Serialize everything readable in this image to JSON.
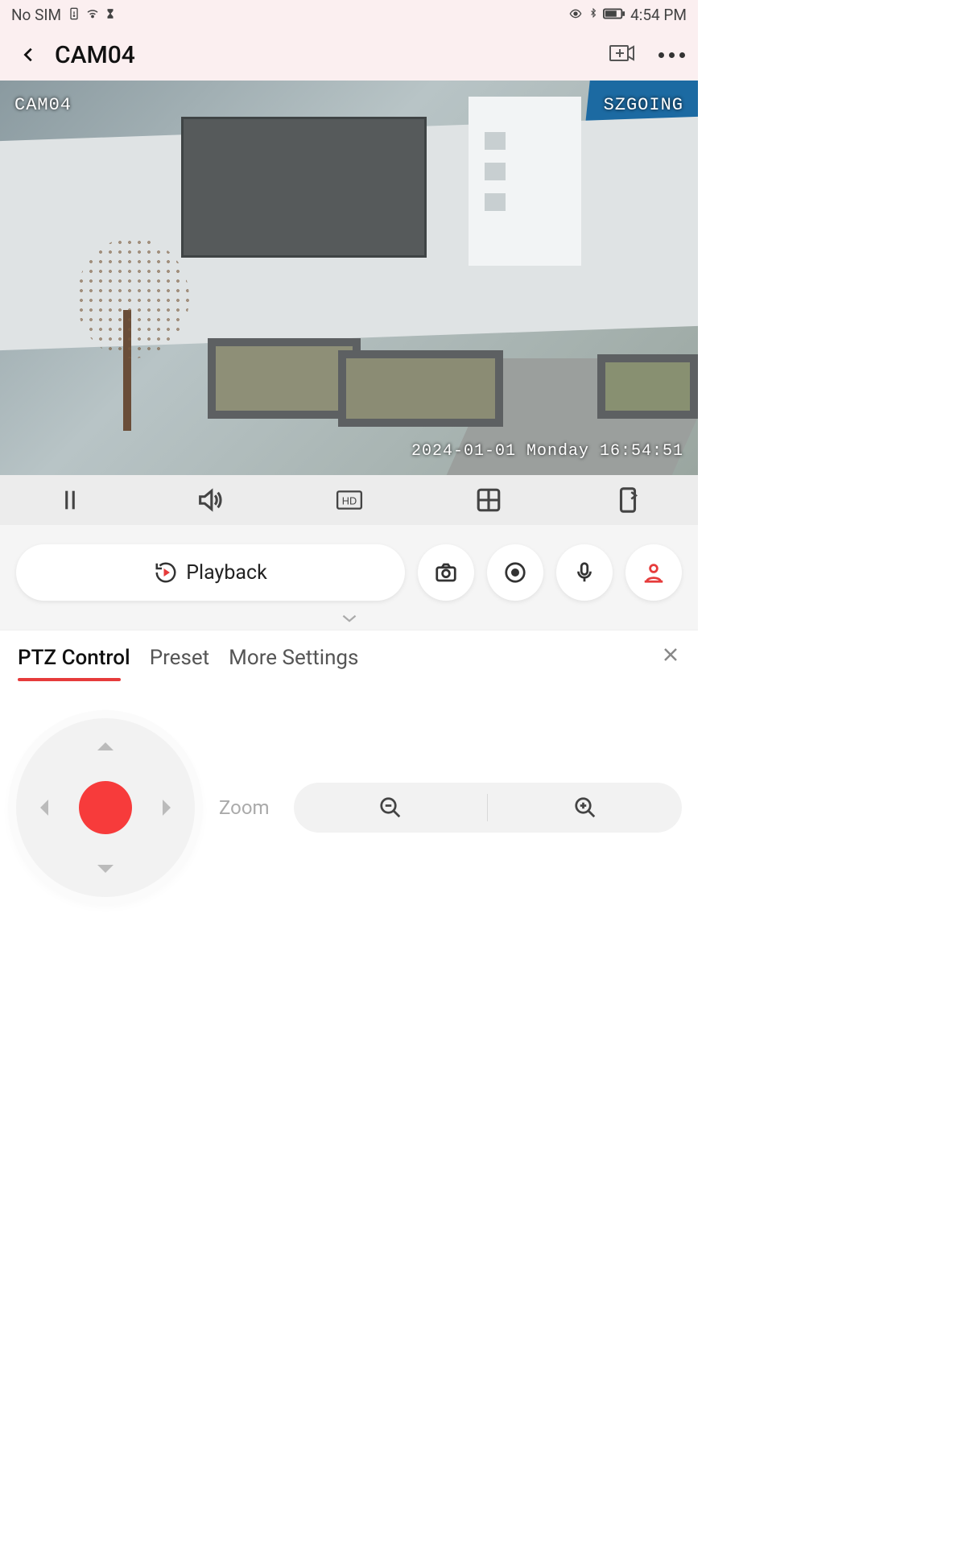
{
  "status": {
    "sim": "No SIM",
    "time": "4:54 PM"
  },
  "header": {
    "title": "CAM04"
  },
  "video": {
    "top_left": "CAM04",
    "top_right": "SZGOING",
    "timestamp": "2024-01-01 Monday 16:54:51"
  },
  "toolbar": {
    "hd_label": "HD"
  },
  "actions": {
    "playback_label": "Playback"
  },
  "tabs": {
    "ptz": "PTZ Control",
    "preset": "Preset",
    "more": "More Settings"
  },
  "ptz": {
    "zoom_label": "Zoom"
  }
}
